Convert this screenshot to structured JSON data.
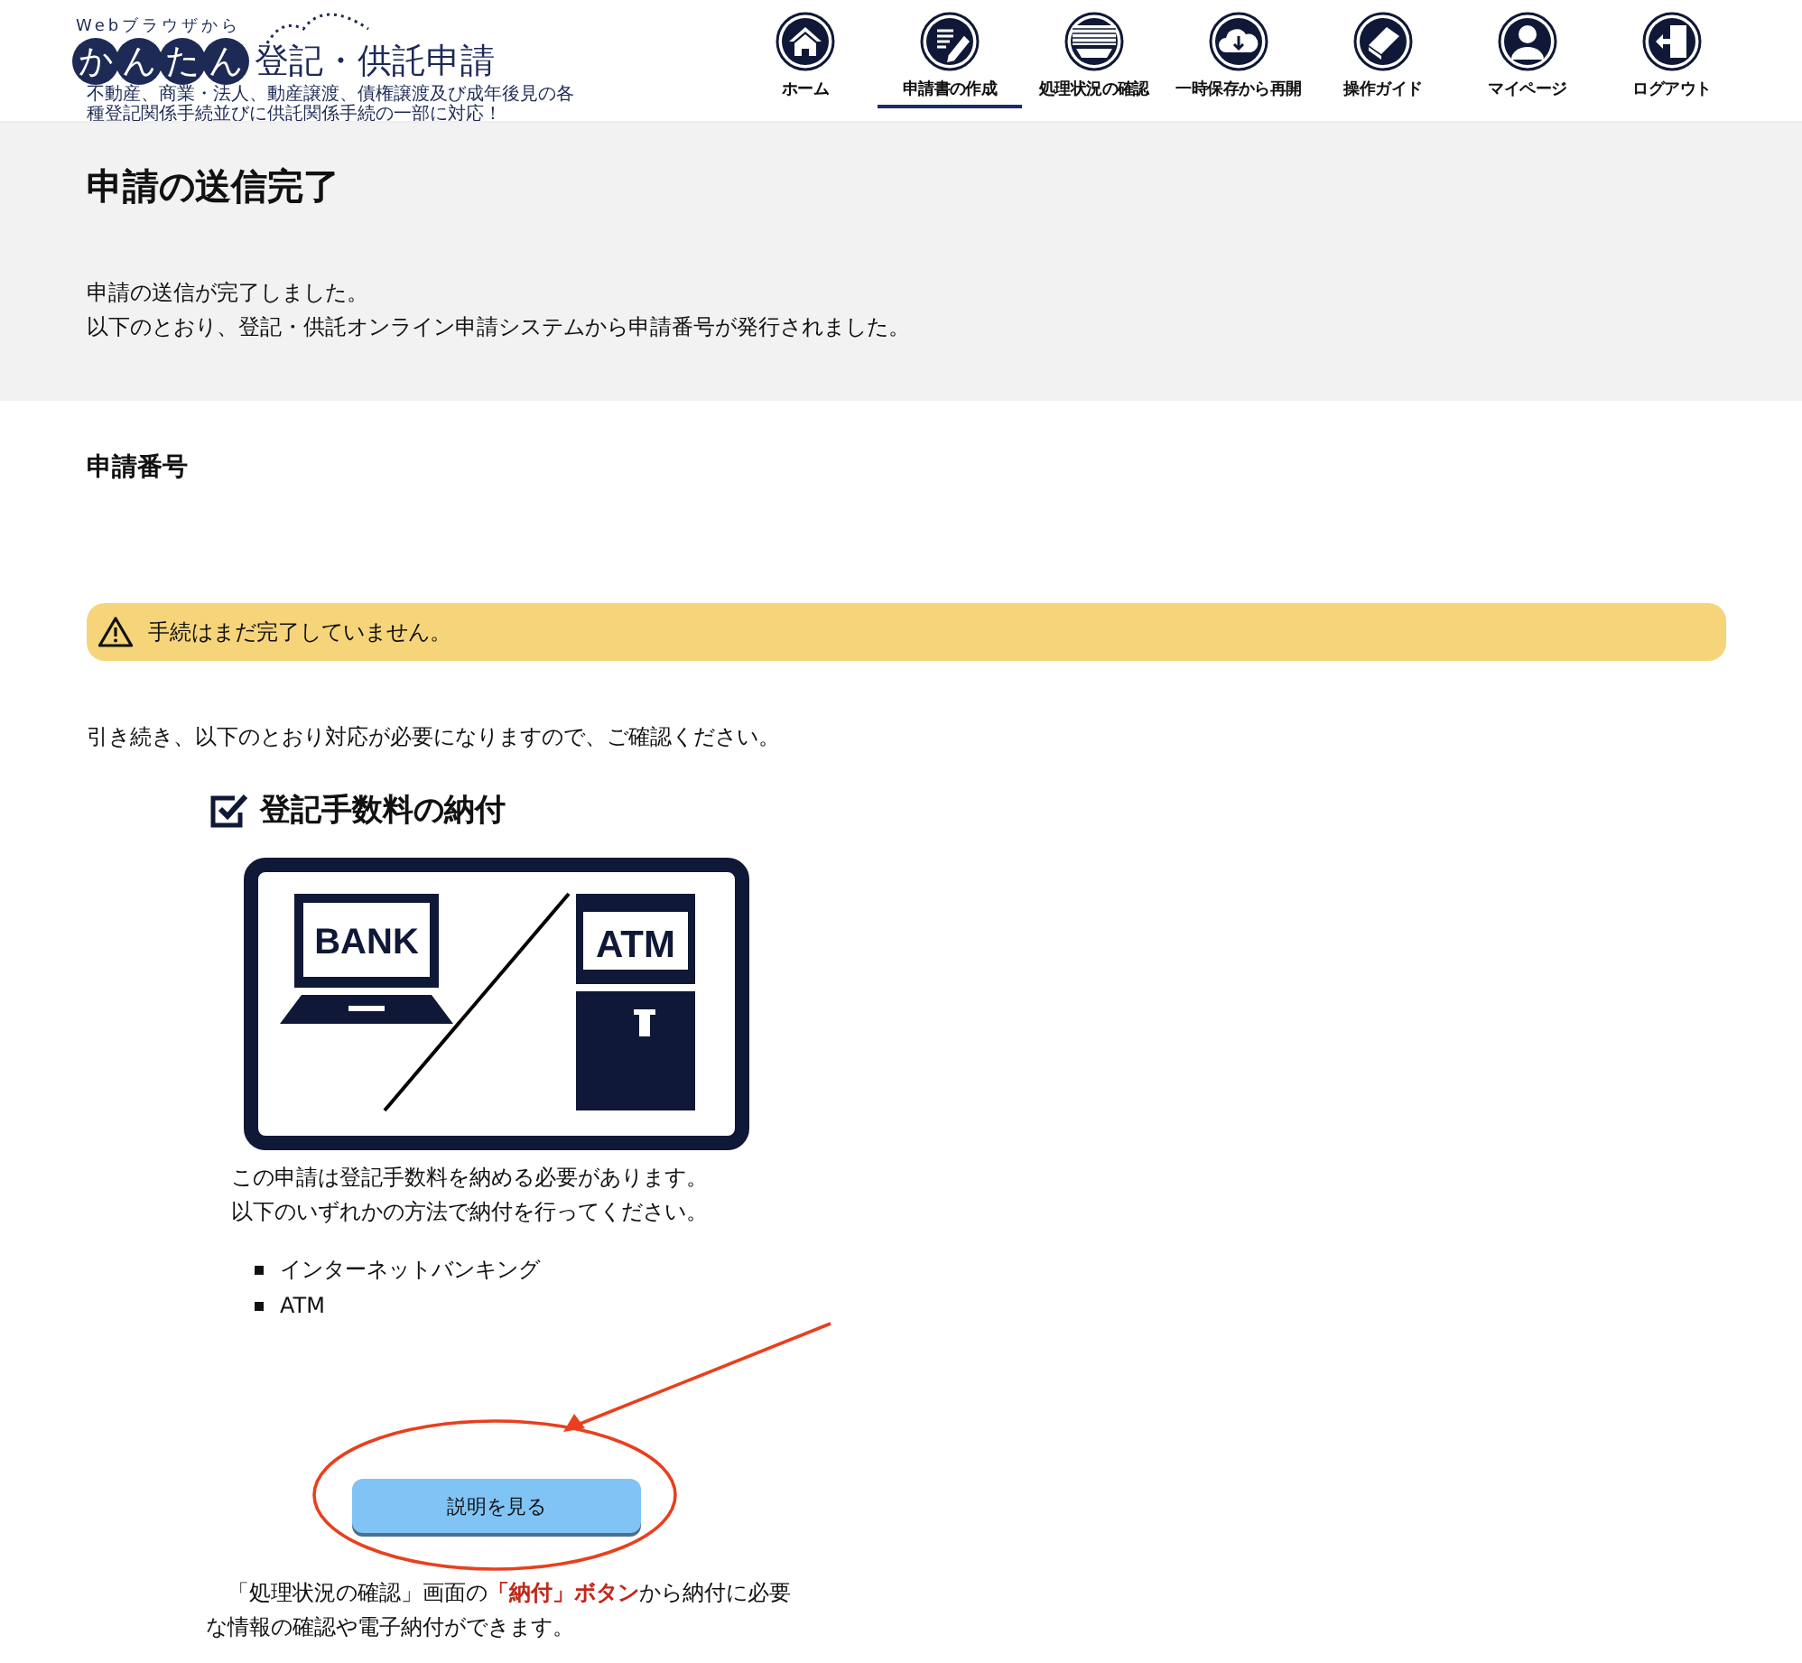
{
  "logo": {
    "tagline": "Webブラウザから",
    "mark": "かんたん",
    "title": "登記・供託申請",
    "subtitle": "不動産、商業・法人、動産譲渡、債権譲渡及び成年後見の各種登記関係手続並びに供託関係手続の一部に対応！"
  },
  "nav": [
    {
      "label": "ホーム",
      "kind": "home",
      "selected": false
    },
    {
      "label": "申請書の作成",
      "kind": "write",
      "selected": true
    },
    {
      "label": "処理状況の確認",
      "kind": "tray",
      "selected": false
    },
    {
      "label": "一時保存から再開",
      "kind": "cloud",
      "selected": false
    },
    {
      "label": "操作ガイド",
      "kind": "book",
      "selected": false
    },
    {
      "label": "マイページ",
      "kind": "person",
      "selected": false
    },
    {
      "label": "ログアウト",
      "kind": "logout",
      "selected": false
    }
  ],
  "banner": {
    "title": "申請の送信完了",
    "lines": [
      "申請の送信が完了しました。",
      "以下のとおり、登記・供託オンライン申請システムから申請番号が発行されました。"
    ]
  },
  "number_heading": "申請番号",
  "warning": "手続はまだ完了していません。",
  "intro": "引き続き、以下のとおり対応が必要になりますので、ご確認ください。",
  "task": {
    "title": "登記手数料の納付",
    "illustration": {
      "bank": "BANK",
      "atm": "ATM"
    },
    "lines": [
      "この申請は登記手数料を納める必要があります。",
      "以下のいずれかの方法で納付を行ってください。"
    ],
    "methods": [
      "インターネットバンキング",
      "ATM"
    ],
    "button": "説明を見る",
    "note": "「処理状況の確認」画面の**「納付」ボタン**から納付に必要な情報の確認や電子納付ができます。"
  }
}
